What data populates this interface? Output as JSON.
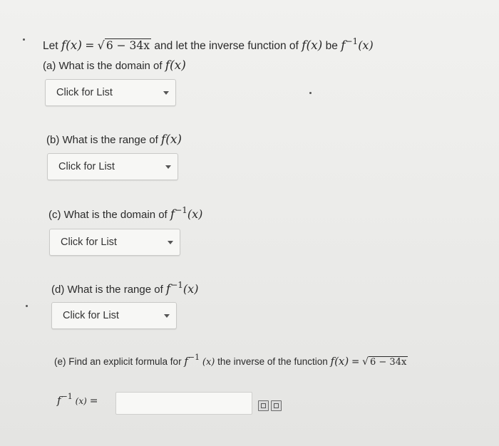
{
  "question": {
    "prefix": "Let",
    "f_of_x": "f(x)",
    "equals": "=",
    "radicand": "6 − 34x",
    "middle": "and let the inverse function of",
    "be": "be",
    "f_inverse_base": "f",
    "f_inverse_sup": "−1",
    "f_inverse_arg": "(x)"
  },
  "parts": [
    {
      "label": "(a) What is the domain of",
      "func": "f(x)",
      "select": "Click for List"
    },
    {
      "label": "(b) What is the range of",
      "func": "f(x)",
      "select": "Click for List"
    },
    {
      "label": "(c) What is the domain of",
      "func_base": "f",
      "func_sup": "−1",
      "func_arg": "(x)",
      "select": "Click for List"
    },
    {
      "label": "(d) What is the range of",
      "func_base": "f",
      "func_sup": "−1",
      "func_arg": "(x)",
      "select": "Click for List"
    }
  ],
  "part_e": {
    "prefix": "(e) Find an explicit formula for",
    "finv_base": "f",
    "finv_sup": "−1",
    "finv_arg": "(x)",
    "middle": "the inverse of the function",
    "func": "f(x)",
    "equals": "=",
    "radicand": "6 − 34x",
    "answer_lhs_base": "f",
    "answer_lhs_sup": "−1",
    "answer_lhs_arg": "(x)",
    "answer_equals": "=",
    "answer_value": ""
  },
  "icons": [
    "equation-editor-icon",
    "preview-icon"
  ]
}
